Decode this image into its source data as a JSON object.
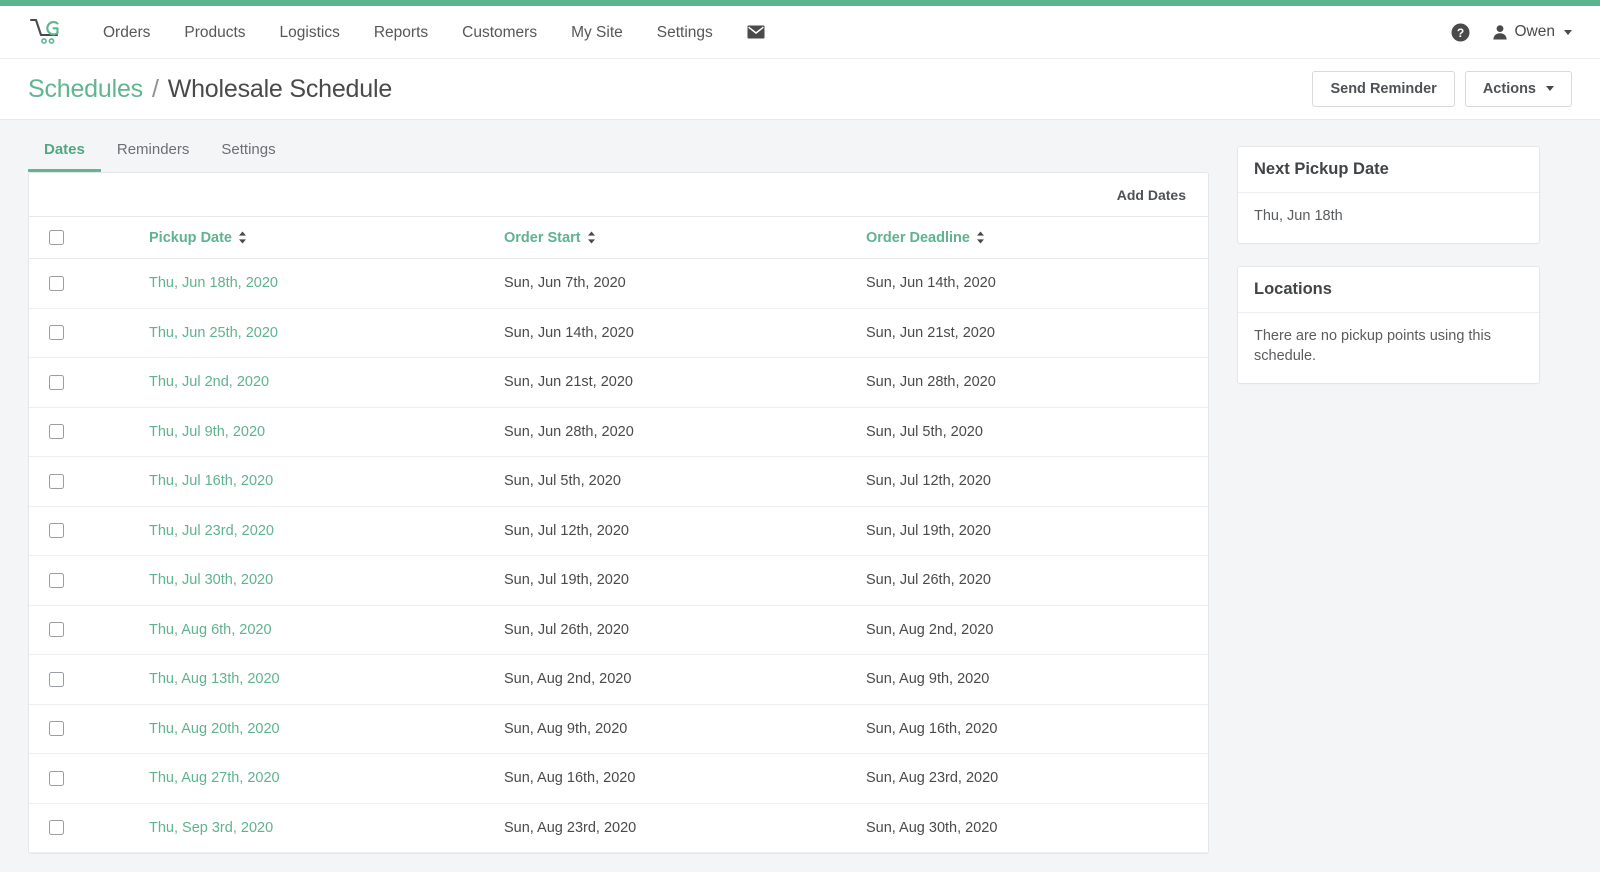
{
  "theme": {
    "accent": "#5cb58f",
    "accent_text": "#5fb38e",
    "page_bg": "#f4f5f7",
    "text": "#4a4a4a"
  },
  "navbar": {
    "logo_icon": "shopping-cart-logo-icon",
    "links": [
      {
        "label": "Orders",
        "name": "nav-link-orders"
      },
      {
        "label": "Products",
        "name": "nav-link-products"
      },
      {
        "label": "Logistics",
        "name": "nav-link-logistics"
      },
      {
        "label": "Reports",
        "name": "nav-link-reports"
      },
      {
        "label": "Customers",
        "name": "nav-link-customers"
      },
      {
        "label": "My Site",
        "name": "nav-link-my-site"
      },
      {
        "label": "Settings",
        "name": "nav-link-settings"
      }
    ],
    "mail_icon": "envelope-icon",
    "help_icon": "help-circle-icon",
    "user": {
      "avatar_icon": "user-icon",
      "name": "Owen",
      "caret_icon": "chevron-down-icon"
    }
  },
  "page_header": {
    "breadcrumb": {
      "parent": "Schedules",
      "separator": "/",
      "current": "Wholesale Schedule"
    },
    "actions": {
      "send_reminder": "Send Reminder",
      "actions_menu": "Actions",
      "actions_caret_icon": "chevron-down-icon"
    }
  },
  "tabs": [
    {
      "label": "Dates",
      "name": "tab-dates",
      "active": true
    },
    {
      "label": "Reminders",
      "name": "tab-reminders",
      "active": false
    },
    {
      "label": "Settings",
      "name": "tab-settings",
      "active": false
    }
  ],
  "table": {
    "toolbar": {
      "add_dates": "Add Dates"
    },
    "select_all_checkbox": "",
    "sort_icon": "sort-updown-icon",
    "columns": [
      {
        "key": "checkbox",
        "label": ""
      },
      {
        "key": "pickup_date",
        "label": "Pickup Date",
        "sortable": true
      },
      {
        "key": "order_start",
        "label": "Order Start",
        "sortable": true
      },
      {
        "key": "order_deadline",
        "label": "Order Deadline",
        "sortable": true
      }
    ],
    "rows": [
      {
        "pickup_date": "Thu, Jun 18th, 2020",
        "order_start": "Sun, Jun 7th, 2020",
        "order_deadline": "Sun, Jun 14th, 2020"
      },
      {
        "pickup_date": "Thu, Jun 25th, 2020",
        "order_start": "Sun, Jun 14th, 2020",
        "order_deadline": "Sun, Jun 21st, 2020"
      },
      {
        "pickup_date": "Thu, Jul 2nd, 2020",
        "order_start": "Sun, Jun 21st, 2020",
        "order_deadline": "Sun, Jun 28th, 2020"
      },
      {
        "pickup_date": "Thu, Jul 9th, 2020",
        "order_start": "Sun, Jun 28th, 2020",
        "order_deadline": "Sun, Jul 5th, 2020"
      },
      {
        "pickup_date": "Thu, Jul 16th, 2020",
        "order_start": "Sun, Jul 5th, 2020",
        "order_deadline": "Sun, Jul 12th, 2020"
      },
      {
        "pickup_date": "Thu, Jul 23rd, 2020",
        "order_start": "Sun, Jul 12th, 2020",
        "order_deadline": "Sun, Jul 19th, 2020"
      },
      {
        "pickup_date": "Thu, Jul 30th, 2020",
        "order_start": "Sun, Jul 19th, 2020",
        "order_deadline": "Sun, Jul 26th, 2020"
      },
      {
        "pickup_date": "Thu, Aug 6th, 2020",
        "order_start": "Sun, Jul 26th, 2020",
        "order_deadline": "Sun, Aug 2nd, 2020"
      },
      {
        "pickup_date": "Thu, Aug 13th, 2020",
        "order_start": "Sun, Aug 2nd, 2020",
        "order_deadline": "Sun, Aug 9th, 2020"
      },
      {
        "pickup_date": "Thu, Aug 20th, 2020",
        "order_start": "Sun, Aug 9th, 2020",
        "order_deadline": "Sun, Aug 16th, 2020"
      },
      {
        "pickup_date": "Thu, Aug 27th, 2020",
        "order_start": "Sun, Aug 16th, 2020",
        "order_deadline": "Sun, Aug 23rd, 2020"
      },
      {
        "pickup_date": "Thu, Sep 3rd, 2020",
        "order_start": "Sun, Aug 23rd, 2020",
        "order_deadline": "Sun, Aug 30th, 2020"
      }
    ]
  },
  "sidebar": {
    "panels": [
      {
        "title": "Next Pickup Date",
        "body": "Thu, Jun 18th"
      },
      {
        "title": "Locations",
        "body": "There are no pickup points using this schedule."
      }
    ]
  }
}
